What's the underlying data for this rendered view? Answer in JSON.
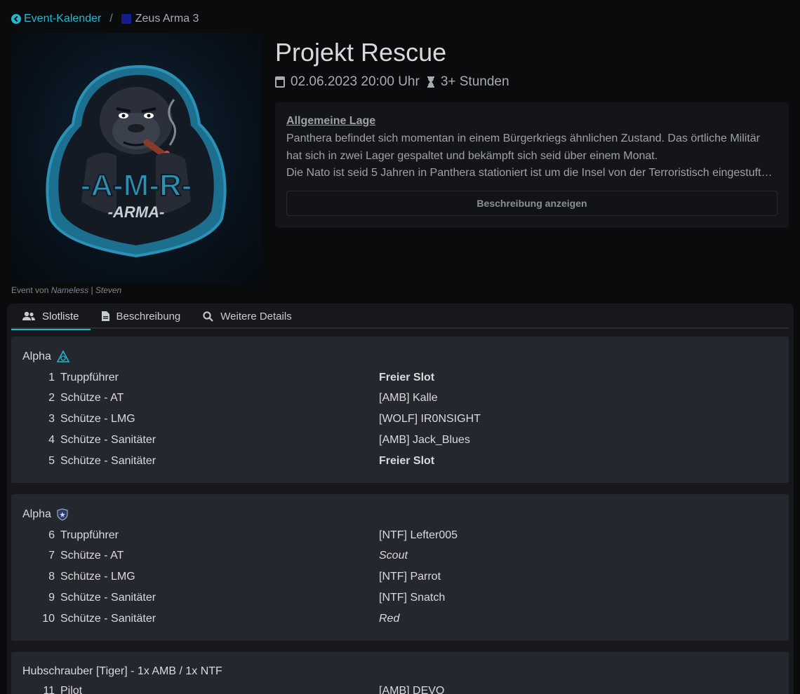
{
  "breadcrumb": {
    "back_label": "Event-Kalender",
    "separator": "/",
    "current": "Zeus Arma 3",
    "current_color": "#141c8f"
  },
  "event": {
    "title": "Projekt Rescue",
    "datetime": "02.06.2023 20:00 Uhr",
    "duration": "3+ Stunden",
    "logo_main_text": "-A-M-R-",
    "logo_sub_text": "-ARMA-",
    "author_prefix": "Event von",
    "author_name": "Nameless | Steven"
  },
  "description": {
    "heading": "Allgemeine Lage",
    "lines": [
      "Panthera befindet sich momentan in einem Bürgerkriegs ähnlichen Zustand. Das örtliche Militär",
      "hat sich in zwei Lager gespaltet und bekämpft sich seid über einem Monat.",
      "Die Nato ist seid 5 Jahren in Panthera stationiert ist um die Insel von der Terroristisch eingestufte…"
    ],
    "show_button": "Beschreibung anzeigen"
  },
  "tabs": [
    {
      "label": "Slotliste",
      "icon": "users-icon",
      "active": true
    },
    {
      "label": "Beschreibung",
      "icon": "file-icon",
      "active": false
    },
    {
      "label": "Weitere Details",
      "icon": "search-icon",
      "active": false
    }
  ],
  "groups": [
    {
      "title": "Alpha",
      "badge": "triangle-squad-icon",
      "slots": [
        {
          "num": "1",
          "role": "Truppführer",
          "user": "Freier Slot",
          "state": "free"
        },
        {
          "num": "2",
          "role": "Schütze - AT",
          "user": "[AMB] Kalle",
          "state": "taken"
        },
        {
          "num": "3",
          "role": "Schütze - LMG",
          "user": "[WOLF] IR0NSIGHT",
          "state": "taken"
        },
        {
          "num": "4",
          "role": "Schütze - Sanitäter",
          "user": "[AMB] Jack_Blues",
          "state": "taken"
        },
        {
          "num": "5",
          "role": "Schütze - Sanitäter",
          "user": "Freier Slot",
          "state": "free"
        }
      ]
    },
    {
      "title": "Alpha",
      "badge": "shield-squad-icon",
      "slots": [
        {
          "num": "6",
          "role": "Truppführer",
          "user": "[NTF] Lefter005",
          "state": "taken"
        },
        {
          "num": "7",
          "role": "Schütze - AT",
          "user": "Scout",
          "state": "reserved"
        },
        {
          "num": "8",
          "role": "Schütze - LMG",
          "user": "[NTF] Parrot",
          "state": "taken"
        },
        {
          "num": "9",
          "role": "Schütze - Sanitäter",
          "user": "[NTF] Snatch",
          "state": "taken"
        },
        {
          "num": "10",
          "role": "Schütze - Sanitäter",
          "user": "Red",
          "state": "reserved"
        }
      ]
    },
    {
      "title": "Hubschrauber [Tiger] - 1x AMB / 1x NTF",
      "badge": "",
      "slots": [
        {
          "num": "11",
          "role": "Pilot",
          "user": "[AMB] DEVO",
          "state": "taken"
        }
      ]
    }
  ],
  "colors": {
    "accent": "#22b8cf",
    "background": "#0a0b0d",
    "card": "#25272e"
  }
}
